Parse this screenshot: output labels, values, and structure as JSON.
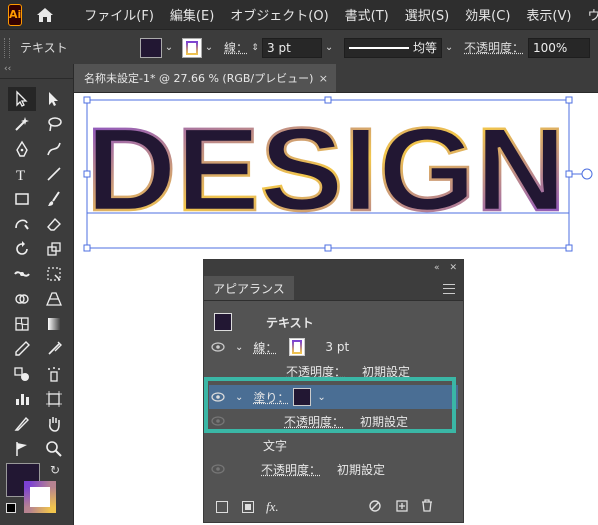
{
  "app": {
    "logo": "Ai"
  },
  "menu": {
    "items": [
      "ファイル(F)",
      "編集(E)",
      "オブジェクト(O)",
      "書式(T)",
      "選択(S)",
      "効果(C)",
      "表示(V)",
      "ウィン"
    ]
  },
  "control": {
    "object_type": "テキスト",
    "stroke_label": "線：",
    "stroke_weight": "3 pt",
    "line_style": "均等",
    "opacity_label": "不透明度：",
    "opacity_value": "100%"
  },
  "document": {
    "tab_title": "名称未設定-1* @ 27.66 % (RGB/プレビュー)",
    "close": "×"
  },
  "canvas": {
    "text": "DESIGN"
  },
  "appearance": {
    "title": "アピアランス",
    "object": "テキスト",
    "stroke_label": "線：",
    "stroke_value": "3 pt",
    "stroke_opacity_label": "不透明度：",
    "stroke_opacity_value": "初期設定",
    "fill_label": "塗り：",
    "fill_opacity_label": "不透明度：",
    "fill_opacity_value": "初期設定",
    "char_label": "文字",
    "char_opacity_label": "不透明度：",
    "char_opacity_value": "初期設定",
    "fx": "fx."
  },
  "colors": {
    "fill": "#221733",
    "stroke_gradient_start": "#7a3fd6",
    "stroke_gradient_end": "#f2c64b",
    "highlight": "#3ab7a6",
    "selected_row": "#4a6e94"
  }
}
